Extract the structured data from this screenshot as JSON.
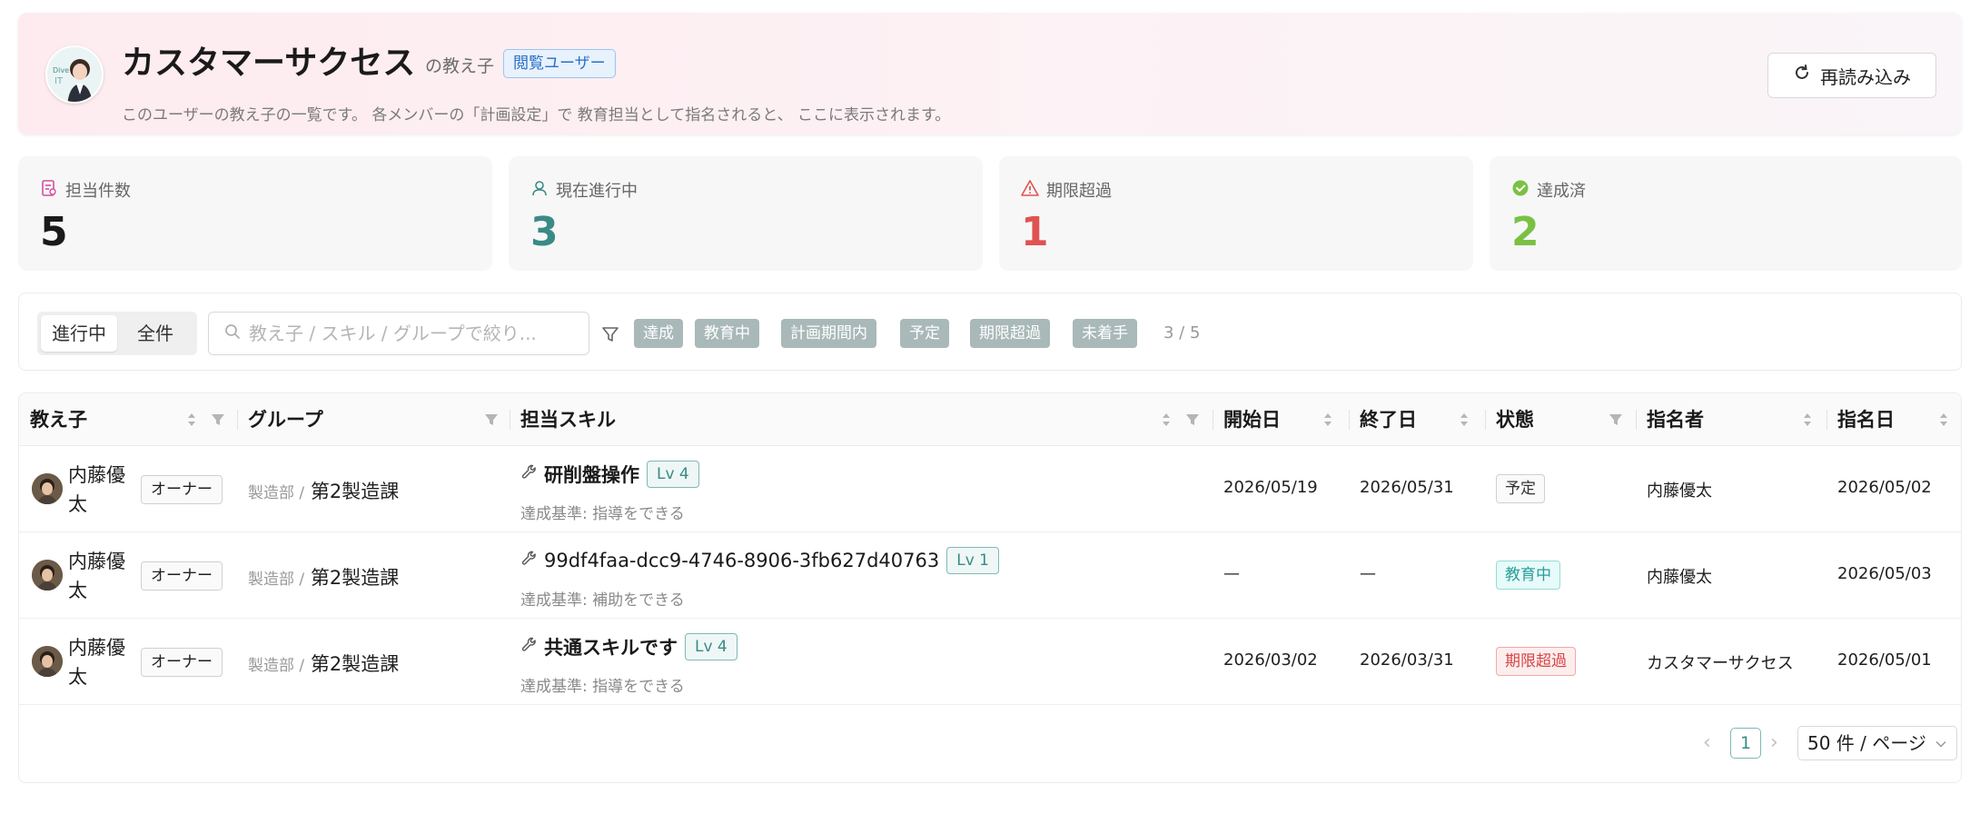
{
  "header": {
    "title": "カスタマーサクセス",
    "subtitle": "の教え子",
    "role_badge": "閲覧ユーザー",
    "description": "このユーザーの教え子の一覧です。 各メンバーの「計画設定」で 教育担当として指名されると、 ここに表示されます。",
    "reload_label": "再読み込み"
  },
  "stats": [
    {
      "label": "担当件数",
      "value": "5",
      "color": "#1a1a1a",
      "icon": "list-icon"
    },
    {
      "label": "現在進行中",
      "value": "3",
      "color": "#3a8a86",
      "icon": "user-icon"
    },
    {
      "label": "期限超過",
      "value": "1",
      "color": "#e05252",
      "icon": "warning-icon"
    },
    {
      "label": "達成済",
      "value": "2",
      "color": "#7ac143",
      "icon": "check-circle-icon"
    }
  ],
  "filters": {
    "segments": [
      "進行中",
      "全件"
    ],
    "active_segment": "進行中",
    "search_placeholder": "教え子 / スキル / グループで絞り...",
    "chips": [
      "達成",
      "教育中",
      "計画期間内",
      "予定",
      "期限超過",
      "未着手"
    ],
    "count": "3 / 5"
  },
  "table": {
    "columns": [
      "教え子",
      "グループ",
      "担当スキル",
      "開始日",
      "終了日",
      "状態",
      "指名者",
      "指名日"
    ],
    "rows": [
      {
        "name": "内藤優太",
        "role": "オーナー",
        "dept": "製造部 /",
        "group": "第2製造課",
        "skill": "研削盤操作",
        "level": "Lv 4",
        "criteria": "達成基準: 指導をできる",
        "start": "2026/05/19",
        "end": "2026/05/31",
        "status": "予定",
        "status_kind": "planned",
        "nominator": "内藤優太",
        "nominated": "2026/05/02"
      },
      {
        "name": "内藤優太",
        "role": "オーナー",
        "dept": "製造部 /",
        "group": "第2製造課",
        "skill": "99df4faa-dcc9-4746-8906-3fb627d40763",
        "level": "Lv 1",
        "criteria": "達成基準: 補助をできる",
        "start": "—",
        "end": "—",
        "status": "教育中",
        "status_kind": "training",
        "nominator": "内藤優太",
        "nominated": "2026/05/03"
      },
      {
        "name": "内藤優太",
        "role": "オーナー",
        "dept": "製造部 /",
        "group": "第2製造課",
        "skill": "共通スキルです",
        "level": "Lv 4",
        "criteria": "達成基準: 指導をできる",
        "start": "2026/03/02",
        "end": "2026/03/31",
        "status": "期限超過",
        "status_kind": "overdue",
        "nominator": "カスタマーサクセス",
        "nominated": "2026/05/01"
      }
    ]
  },
  "pagination": {
    "current_page": "1",
    "page_size": "50 件 / ページ"
  }
}
